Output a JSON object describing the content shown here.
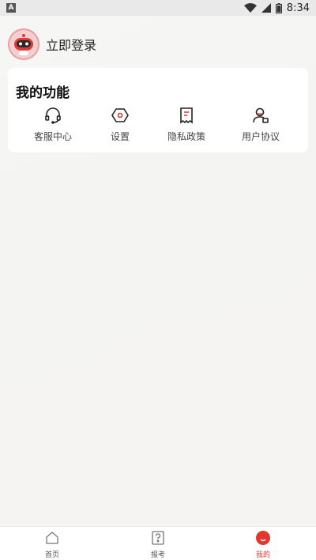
{
  "status_bar": {
    "left_badge": "A",
    "time": "8:34",
    "icons": [
      "wifi-icon",
      "signal-icon",
      "battery-icon"
    ]
  },
  "header": {
    "login_label": "立即登录",
    "avatar_icon": "robot-avatar-icon"
  },
  "functions": {
    "title": "我的功能",
    "items": [
      {
        "label": "客服中心",
        "icon": "headset-icon"
      },
      {
        "label": "设置",
        "icon": "settings-icon"
      },
      {
        "label": "隐私政策",
        "icon": "document-icon"
      },
      {
        "label": "用户协议",
        "icon": "user-agreement-icon"
      }
    ]
  },
  "bottom_nav": {
    "items": [
      {
        "label": "首页",
        "icon": "home-icon",
        "active": false
      },
      {
        "label": "报考",
        "icon": "question-icon",
        "active": false
      },
      {
        "label": "我的",
        "icon": "profile-icon",
        "active": true
      }
    ]
  },
  "colors": {
    "accent": "#e2382e",
    "card_bg": "#ffffff",
    "page_bg": "#f5f5f3"
  }
}
